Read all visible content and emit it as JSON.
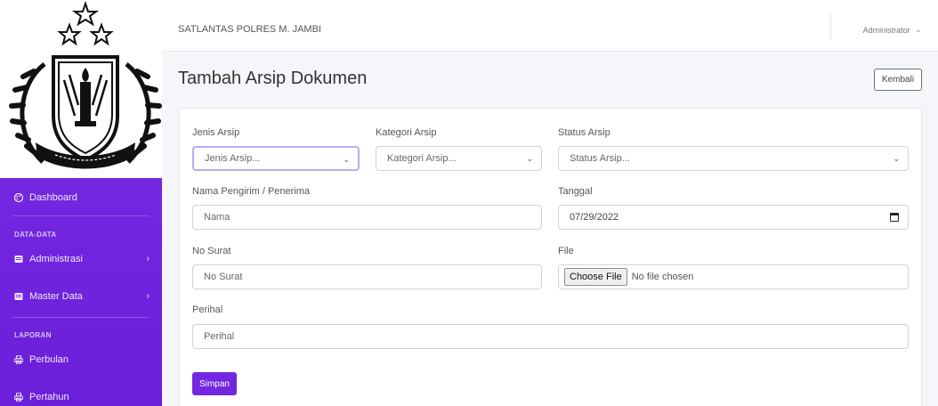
{
  "sidebar": {
    "dashboard": {
      "label": "Dashboard",
      "icon": "palette-icon"
    },
    "section_data": "DATA-DATA",
    "administrasi": {
      "label": "Administrasi",
      "icon": "folder-icon"
    },
    "master_data": {
      "label": "Master Data",
      "icon": "folder-icon"
    },
    "section_laporan": "LAPORAN",
    "perbulan": {
      "label": "Perbulan",
      "icon": "printer-icon"
    },
    "pertahun": {
      "label": "Pertahun",
      "icon": "printer-icon"
    }
  },
  "topbar": {
    "brand": "SATLANTAS POLRES M. JAMBI",
    "user": "Administrator"
  },
  "page": {
    "title": "Tambah Arsip Dokumen",
    "back_label": "Kembali"
  },
  "form": {
    "jenis_arsip": {
      "label": "Jenis Arsip",
      "value": "Jenis Arsip..."
    },
    "kategori_arsip": {
      "label": "Kategori Arsip",
      "value": "Kategori Arsip..."
    },
    "status_arsip": {
      "label": "Status Arsip",
      "value": "Status Arsip..."
    },
    "nama": {
      "label": "Nama Pengirim / Penerima",
      "placeholder": "Nama"
    },
    "tanggal": {
      "label": "Tanggal",
      "value": "07/29/2022"
    },
    "no_surat": {
      "label": "No Surat",
      "placeholder": "No Surat"
    },
    "file": {
      "label": "File",
      "button": "Choose File",
      "status": "No file chosen"
    },
    "perihal": {
      "label": "Perihal",
      "placeholder": "Perihal"
    },
    "save_label": "Simpan"
  },
  "colors": {
    "accent": "#7327e0",
    "focus_border": "#b5aef5"
  }
}
